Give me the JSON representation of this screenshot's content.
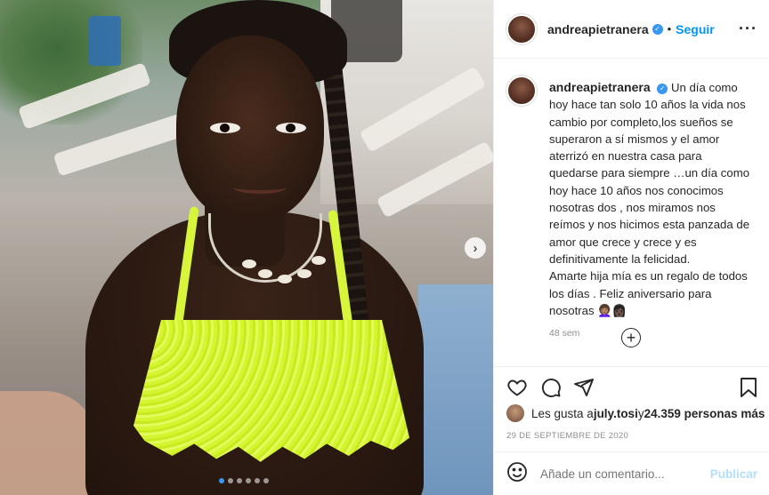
{
  "post": {
    "media": {
      "description_icon": "photo",
      "carousel_next_icon": "chevron-right-icon",
      "carousel_dots": 6,
      "active_dot": 0
    },
    "header": {
      "username": "andreapietranera",
      "separator": "•",
      "follow_label": "Seguir",
      "more_label": "···"
    },
    "caption": {
      "username": "andreapietranera",
      "text": "Un día como hoy hace tan solo 10 años la vida nos cambio por completo,los sueños se superaron a sí mismos y el amor aterrizó en nuestra casa para quedarse para siempre …un día como hoy hace 10 años nos conocimos nosotras dos , nos miramos nos reímos y nos hicimos esta panzada de amor que crece y crece y es definitivamente la felicidad.",
      "text2": "Amarte hija mía es un regalo de todos los días . Feliz aniversario para nosotras",
      "emoji": "👩🏽‍🦱👩🏿",
      "time": "48 sem"
    },
    "likes": {
      "prefix": "Les gusta a ",
      "user": "july.tosi",
      "middle": " y ",
      "count": "24.359 personas más"
    },
    "date": "29 DE SEPTIEMBRE DE 2020",
    "comment": {
      "placeholder": "Añade un comentario...",
      "publish_label": "Publicar"
    },
    "colors": {
      "accent": "#0095f6",
      "verified": "#3897f0",
      "publish_disabled": "#b2dffc",
      "muted": "#8e8e8e"
    }
  }
}
